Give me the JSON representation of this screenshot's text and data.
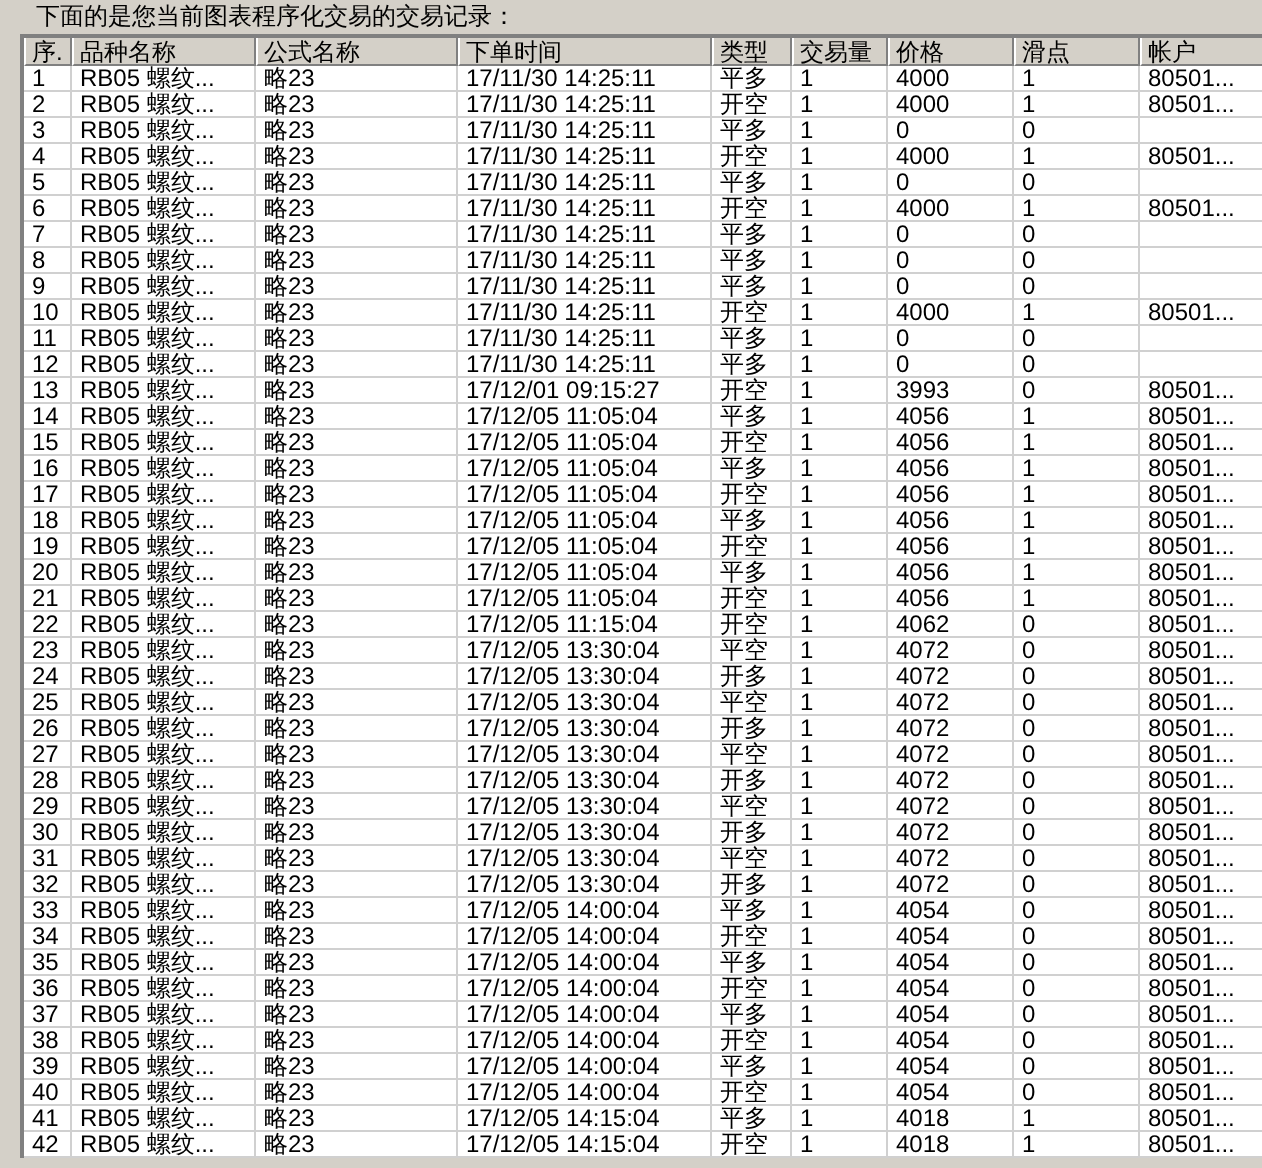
{
  "title": "下面的是您当前图表程序化交易的交易记录：",
  "table": {
    "columns": [
      "序.",
      "品种名称",
      "公式名称",
      "下单时间",
      "类型",
      "交易量",
      "价格",
      "滑点",
      "帐户"
    ],
    "rows": [
      {
        "no": "1",
        "product": "RB05 螺纹...",
        "formula": "略23",
        "time": "17/11/30 14:25:11",
        "type": "平多",
        "qty": "1",
        "price": "4000",
        "slip": "1",
        "account": "80501..."
      },
      {
        "no": "2",
        "product": "RB05 螺纹...",
        "formula": "略23",
        "time": "17/11/30 14:25:11",
        "type": "开空",
        "qty": "1",
        "price": "4000",
        "slip": "1",
        "account": "80501..."
      },
      {
        "no": "3",
        "product": "RB05 螺纹...",
        "formula": "略23",
        "time": "17/11/30 14:25:11",
        "type": "平多",
        "qty": "1",
        "price": "0",
        "slip": "0"
      },
      {
        "no": "4",
        "product": "RB05 螺纹...",
        "formula": "略23",
        "time": "17/11/30 14:25:11",
        "type": "开空",
        "qty": "1",
        "price": "4000",
        "slip": "1",
        "account": "80501..."
      },
      {
        "no": "5",
        "product": "RB05 螺纹...",
        "formula": "略23",
        "time": "17/11/30 14:25:11",
        "type": "平多",
        "qty": "1",
        "price": "0",
        "slip": "0"
      },
      {
        "no": "6",
        "product": "RB05 螺纹...",
        "formula": "略23",
        "time": "17/11/30 14:25:11",
        "type": "开空",
        "qty": "1",
        "price": "4000",
        "slip": "1",
        "account": "80501..."
      },
      {
        "no": "7",
        "product": "RB05 螺纹...",
        "formula": "略23",
        "time": "17/11/30 14:25:11",
        "type": "平多",
        "qty": "1",
        "price": "0",
        "slip": "0"
      },
      {
        "no": "8",
        "product": "RB05 螺纹...",
        "formula": "略23",
        "time": "17/11/30 14:25:11",
        "type": "平多",
        "qty": "1",
        "price": "0",
        "slip": "0"
      },
      {
        "no": "9",
        "product": "RB05 螺纹...",
        "formula": "略23",
        "time": "17/11/30 14:25:11",
        "type": "平多",
        "qty": "1",
        "price": "0",
        "slip": "0"
      },
      {
        "no": "10",
        "product": "RB05 螺纹...",
        "formula": "略23",
        "time": "17/11/30 14:25:11",
        "type": "开空",
        "qty": "1",
        "price": "4000",
        "slip": "1",
        "account": "80501..."
      },
      {
        "no": "11",
        "product": "RB05 螺纹...",
        "formula": "略23",
        "time": "17/11/30 14:25:11",
        "type": "平多",
        "qty": "1",
        "price": "0",
        "slip": "0"
      },
      {
        "no": "12",
        "product": "RB05 螺纹...",
        "formula": "略23",
        "time": "17/11/30 14:25:11",
        "type": "平多",
        "qty": "1",
        "price": "0",
        "slip": "0"
      },
      {
        "no": "13",
        "product": "RB05 螺纹...",
        "formula": "略23",
        "time": "17/12/01 09:15:27",
        "type": "开空",
        "qty": "1",
        "price": "3993",
        "slip": "0",
        "account": "80501..."
      },
      {
        "no": "14",
        "product": "RB05 螺纹...",
        "formula": "略23",
        "time": "17/12/05 11:05:04",
        "type": "平多",
        "qty": "1",
        "price": "4056",
        "slip": "1",
        "account": "80501..."
      },
      {
        "no": "15",
        "product": "RB05 螺纹...",
        "formula": "略23",
        "time": "17/12/05 11:05:04",
        "type": "开空",
        "qty": "1",
        "price": "4056",
        "slip": "1",
        "account": "80501..."
      },
      {
        "no": "16",
        "product": "RB05 螺纹...",
        "formula": "略23",
        "time": "17/12/05 11:05:04",
        "type": "平多",
        "qty": "1",
        "price": "4056",
        "slip": "1",
        "account": "80501..."
      },
      {
        "no": "17",
        "product": "RB05 螺纹...",
        "formula": "略23",
        "time": "17/12/05 11:05:04",
        "type": "开空",
        "qty": "1",
        "price": "4056",
        "slip": "1",
        "account": "80501..."
      },
      {
        "no": "18",
        "product": "RB05 螺纹...",
        "formula": "略23",
        "time": "17/12/05 11:05:04",
        "type": "平多",
        "qty": "1",
        "price": "4056",
        "slip": "1",
        "account": "80501..."
      },
      {
        "no": "19",
        "product": "RB05 螺纹...",
        "formula": "略23",
        "time": "17/12/05 11:05:04",
        "type": "开空",
        "qty": "1",
        "price": "4056",
        "slip": "1",
        "account": "80501..."
      },
      {
        "no": "20",
        "product": "RB05 螺纹...",
        "formula": "略23",
        "time": "17/12/05 11:05:04",
        "type": "平多",
        "qty": "1",
        "price": "4056",
        "slip": "1",
        "account": "80501..."
      },
      {
        "no": "21",
        "product": "RB05 螺纹...",
        "formula": "略23",
        "time": "17/12/05 11:05:04",
        "type": "开空",
        "qty": "1",
        "price": "4056",
        "slip": "1",
        "account": "80501..."
      },
      {
        "no": "22",
        "product": "RB05 螺纹...",
        "formula": "略23",
        "time": "17/12/05 11:15:04",
        "type": "开空",
        "qty": "1",
        "price": "4062",
        "slip": "0",
        "account": "80501..."
      },
      {
        "no": "23",
        "product": "RB05 螺纹...",
        "formula": "略23",
        "time": "17/12/05 13:30:04",
        "type": "平空",
        "qty": "1",
        "price": "4072",
        "slip": "0",
        "account": "80501..."
      },
      {
        "no": "24",
        "product": "RB05 螺纹...",
        "formula": "略23",
        "time": "17/12/05 13:30:04",
        "type": "开多",
        "qty": "1",
        "price": "4072",
        "slip": "0",
        "account": "80501..."
      },
      {
        "no": "25",
        "product": "RB05 螺纹...",
        "formula": "略23",
        "time": "17/12/05 13:30:04",
        "type": "平空",
        "qty": "1",
        "price": "4072",
        "slip": "0",
        "account": "80501..."
      },
      {
        "no": "26",
        "product": "RB05 螺纹...",
        "formula": "略23",
        "time": "17/12/05 13:30:04",
        "type": "开多",
        "qty": "1",
        "price": "4072",
        "slip": "0",
        "account": "80501..."
      },
      {
        "no": "27",
        "product": "RB05 螺纹...",
        "formula": "略23",
        "time": "17/12/05 13:30:04",
        "type": "平空",
        "qty": "1",
        "price": "4072",
        "slip": "0",
        "account": "80501..."
      },
      {
        "no": "28",
        "product": "RB05 螺纹...",
        "formula": "略23",
        "time": "17/12/05 13:30:04",
        "type": "开多",
        "qty": "1",
        "price": "4072",
        "slip": "0",
        "account": "80501..."
      },
      {
        "no": "29",
        "product": "RB05 螺纹...",
        "formula": "略23",
        "time": "17/12/05 13:30:04",
        "type": "平空",
        "qty": "1",
        "price": "4072",
        "slip": "0",
        "account": "80501..."
      },
      {
        "no": "30",
        "product": "RB05 螺纹...",
        "formula": "略23",
        "time": "17/12/05 13:30:04",
        "type": "开多",
        "qty": "1",
        "price": "4072",
        "slip": "0",
        "account": "80501..."
      },
      {
        "no": "31",
        "product": "RB05 螺纹...",
        "formula": "略23",
        "time": "17/12/05 13:30:04",
        "type": "平空",
        "qty": "1",
        "price": "4072",
        "slip": "0",
        "account": "80501..."
      },
      {
        "no": "32",
        "product": "RB05 螺纹...",
        "formula": "略23",
        "time": "17/12/05 13:30:04",
        "type": "开多",
        "qty": "1",
        "price": "4072",
        "slip": "0",
        "account": "80501..."
      },
      {
        "no": "33",
        "product": "RB05 螺纹...",
        "formula": "略23",
        "time": "17/12/05 14:00:04",
        "type": "平多",
        "qty": "1",
        "price": "4054",
        "slip": "0",
        "account": "80501..."
      },
      {
        "no": "34",
        "product": "RB05 螺纹...",
        "formula": "略23",
        "time": "17/12/05 14:00:04",
        "type": "开空",
        "qty": "1",
        "price": "4054",
        "slip": "0",
        "account": "80501..."
      },
      {
        "no": "35",
        "product": "RB05 螺纹...",
        "formula": "略23",
        "time": "17/12/05 14:00:04",
        "type": "平多",
        "qty": "1",
        "price": "4054",
        "slip": "0",
        "account": "80501..."
      },
      {
        "no": "36",
        "product": "RB05 螺纹...",
        "formula": "略23",
        "time": "17/12/05 14:00:04",
        "type": "开空",
        "qty": "1",
        "price": "4054",
        "slip": "0",
        "account": "80501..."
      },
      {
        "no": "37",
        "product": "RB05 螺纹...",
        "formula": "略23",
        "time": "17/12/05 14:00:04",
        "type": "平多",
        "qty": "1",
        "price": "4054",
        "slip": "0",
        "account": "80501..."
      },
      {
        "no": "38",
        "product": "RB05 螺纹...",
        "formula": "略23",
        "time": "17/12/05 14:00:04",
        "type": "开空",
        "qty": "1",
        "price": "4054",
        "slip": "0",
        "account": "80501..."
      },
      {
        "no": "39",
        "product": "RB05 螺纹...",
        "formula": "略23",
        "time": "17/12/05 14:00:04",
        "type": "平多",
        "qty": "1",
        "price": "4054",
        "slip": "0",
        "account": "80501..."
      },
      {
        "no": "40",
        "product": "RB05 螺纹...",
        "formula": "略23",
        "time": "17/12/05 14:00:04",
        "type": "开空",
        "qty": "1",
        "price": "4054",
        "slip": "0",
        "account": "80501..."
      },
      {
        "no": "41",
        "product": "RB05 螺纹...",
        "formula": "略23",
        "time": "17/12/05 14:15:04",
        "type": "平多",
        "qty": "1",
        "price": "4018",
        "slip": "1",
        "account": "80501..."
      },
      {
        "no": "42",
        "product": "RB05 螺纹...",
        "formula": "略23",
        "time": "17/12/05 14:15:04",
        "type": "开空",
        "qty": "1",
        "price": "4018",
        "slip": "1",
        "account": "80501..."
      }
    ]
  }
}
